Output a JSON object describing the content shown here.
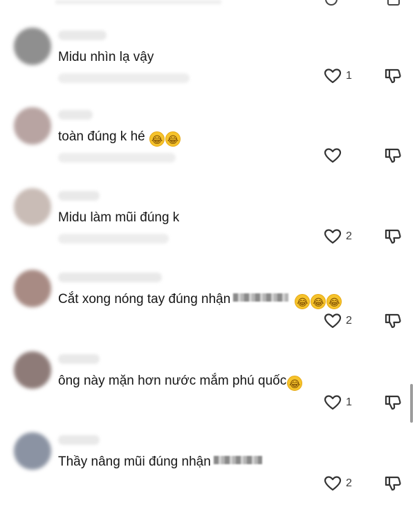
{
  "comments": [
    {
      "text": "Midu nhìn lạ vậy",
      "emojis": [],
      "like_count": "1",
      "avatar_color": "#8f8f8f"
    },
    {
      "text": "toàn đúng k hé ",
      "emojis": [
        "😂",
        "😂"
      ],
      "like_count": "",
      "avatar_color": "#b8a4a2"
    },
    {
      "text": "Midu làm mũi đúng k",
      "emojis": [],
      "like_count": "2",
      "avatar_color": "#c9bcb6"
    },
    {
      "text": "Cắt xong nóng tay đúng nhận",
      "emojis": [
        "😂",
        "😂",
        "😂"
      ],
      "like_count": "2",
      "avatar_color": "#a88b84"
    },
    {
      "text": "ông này mặn hơn nước mắm phú quốc",
      "emojis": [
        "😂"
      ],
      "like_count": "1",
      "avatar_color": "#8e7b78"
    },
    {
      "text": "Thầy nâng mũi đúng nhận",
      "emojis": [],
      "like_count": "2",
      "avatar_color": "#8b93a3"
    }
  ]
}
